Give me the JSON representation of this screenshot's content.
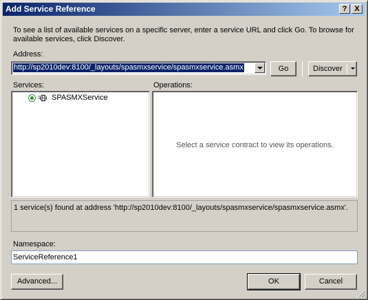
{
  "window": {
    "title": "Add Service Reference",
    "help_label": "?",
    "close_label": "X"
  },
  "intro_text": "To see a list of available services on a specific server, enter a service URL and click Go. To browse for available services, click Discover.",
  "address": {
    "label": "Address:",
    "value": "http://sp2010dev:8100/_layouts/spasmxservice/spasmxservice.asmx"
  },
  "buttons": {
    "go": "Go",
    "discover": "Discover",
    "advanced": "Advanced...",
    "ok": "OK",
    "cancel": "Cancel"
  },
  "services": {
    "label": "Services:",
    "items": [
      {
        "label": "SPASMXService",
        "icon": "service-globe-icon"
      }
    ]
  },
  "operations": {
    "label": "Operations:",
    "empty_message": "Select a service contract to view its operations."
  },
  "status_text": "1 service(s) found at address 'http://sp2010dev:8100/_layouts/spasmxservice/spasmxservice.asmx'.",
  "namespace": {
    "label": "Namespace:",
    "value": "ServiceReference1"
  },
  "colors": {
    "titlebar_start": "#0a246a",
    "titlebar_end": "#a6caf0",
    "dialog_bg": "#d4d0c8",
    "selection": "#0a246a"
  }
}
